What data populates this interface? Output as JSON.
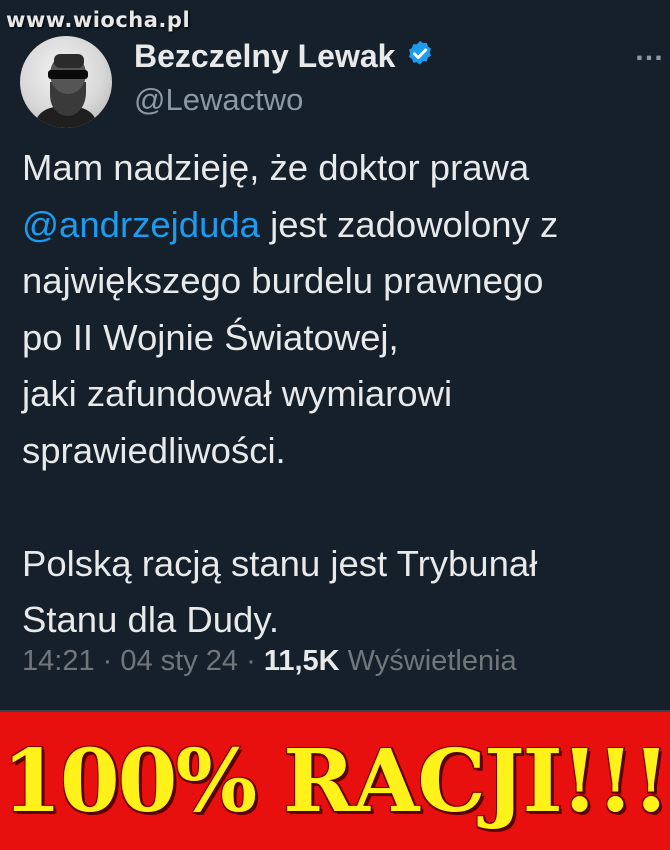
{
  "watermark": "www.wiocha.pl",
  "more_menu": "…",
  "author": {
    "name": "Bezczelny Lewak",
    "handle": "@Lewactwo",
    "verified_icon": "verified-badge-icon"
  },
  "tweet": {
    "lines": [
      [
        "Mam nadzieję, że doktor prawa"
      ],
      [
        "@andrzejduda",
        " jest zadowolony z"
      ],
      [
        "największego burdelu prawnego"
      ],
      [
        "po II Wojnie Światowej,"
      ],
      [
        "jaki zafundował wymiarowi"
      ],
      [
        "sprawiedliwości."
      ],
      [
        "Polską racją stanu jest Trybunał"
      ],
      [
        "Stanu dla Dudy."
      ]
    ],
    "mention": "@andrzejduda"
  },
  "meta": {
    "time": "14:21",
    "sep1": " · ",
    "date": "04 sty 24",
    "sep2": " · ",
    "views_count": "11,5K",
    "views_label": " Wyświetlenia"
  },
  "banner": {
    "text": "100% RACJI!!!"
  },
  "colors": {
    "background": "#15202b",
    "mention": "#1d9bf0",
    "banner_bg": "#e8100f",
    "banner_text": "#fff21a"
  }
}
